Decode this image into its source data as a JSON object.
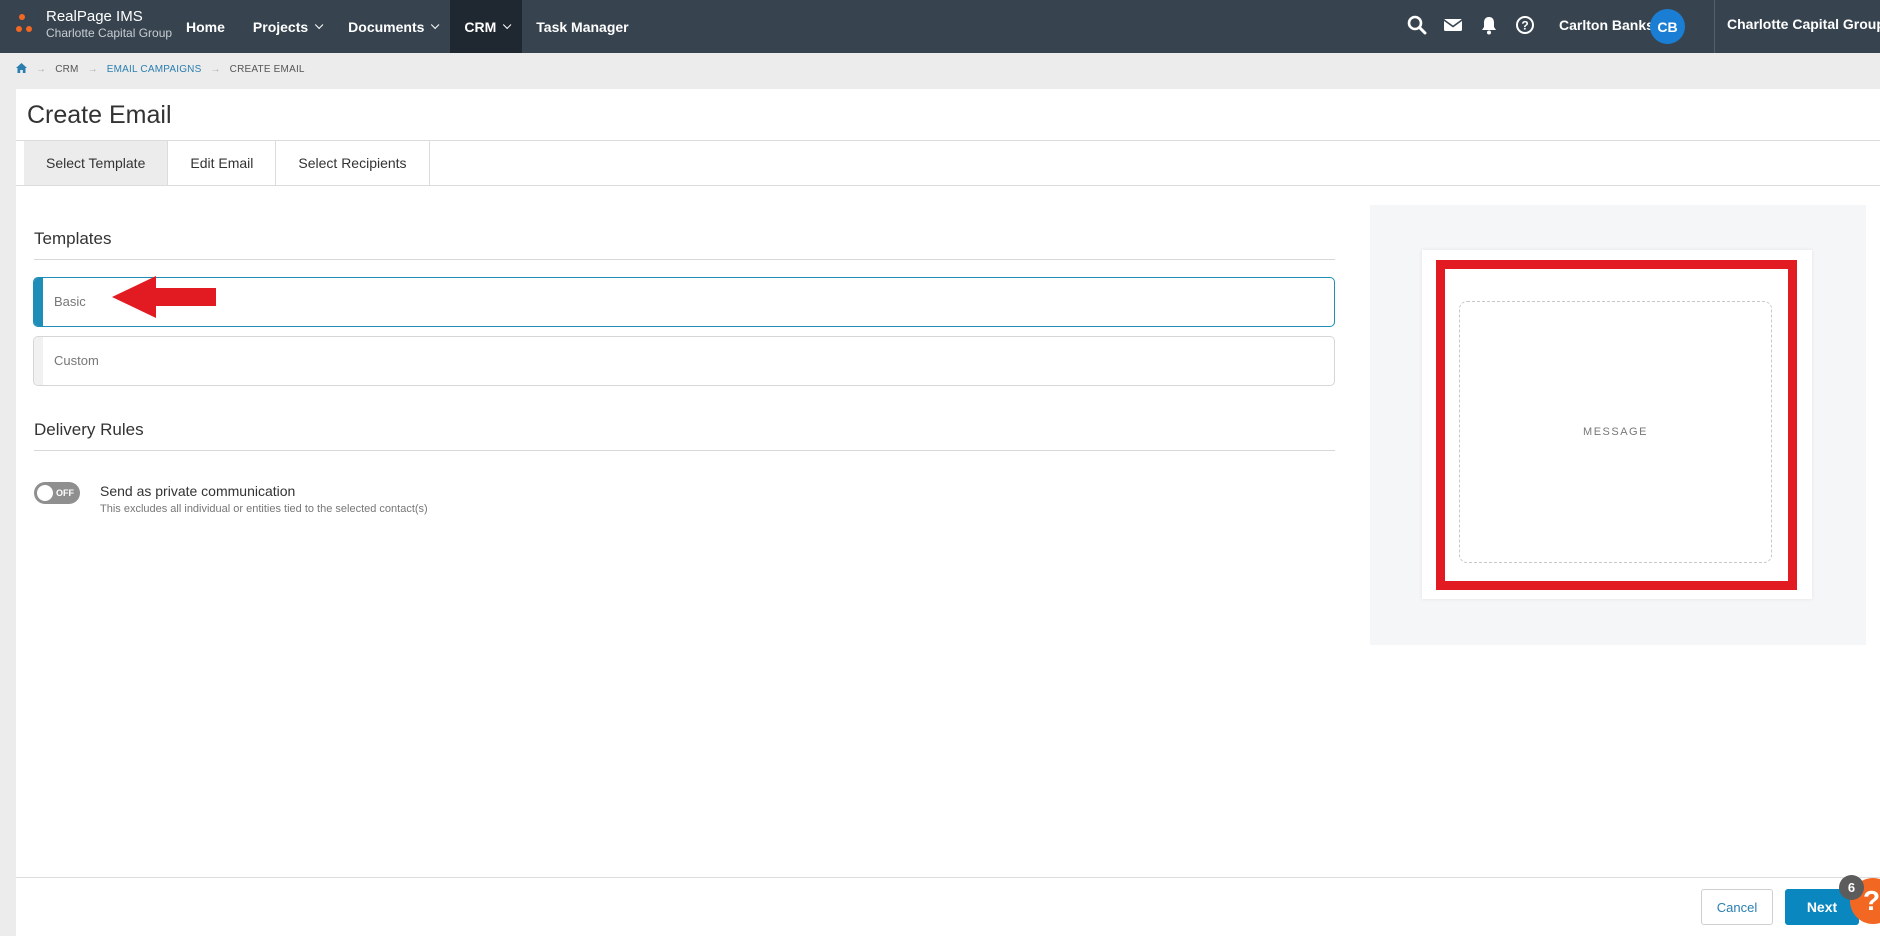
{
  "brand": {
    "name": "RealPage IMS",
    "subtitle": "Charlotte Capital Group",
    "accent": "#f26722"
  },
  "nav": {
    "items": [
      {
        "label": "Home",
        "dropdown": false
      },
      {
        "label": "Projects",
        "dropdown": true
      },
      {
        "label": "Documents",
        "dropdown": true
      },
      {
        "label": "CRM",
        "dropdown": true,
        "active": true
      },
      {
        "label": "Task Manager",
        "dropdown": false
      }
    ],
    "icons": [
      "search-icon",
      "mail-icon",
      "bell-icon",
      "help-icon"
    ],
    "user_name": "Carlton Banks",
    "user_initials": "CB",
    "org": "Charlotte Capital Group"
  },
  "breadcrumb": {
    "home_icon": "home-icon",
    "items": [
      "CRM",
      "EMAIL CAMPAIGNS",
      "CREATE EMAIL"
    ]
  },
  "page": {
    "title": "Create Email"
  },
  "tabs": [
    "Select Template",
    "Edit Email",
    "Select Recipients"
  ],
  "templates": {
    "title": "Templates",
    "items": [
      {
        "label": "Basic",
        "selected": true
      },
      {
        "label": "Custom",
        "selected": false
      }
    ]
  },
  "delivery": {
    "title": "Delivery Rules",
    "toggle_state": "OFF",
    "label": "Send as private communication",
    "description": "This excludes all individual or entities tied to the selected contact(s)"
  },
  "preview": {
    "message_label": "MESSAGE",
    "highlight_color": "#e21b23"
  },
  "footer": {
    "cancel_label": "Cancel",
    "next_label": "Next"
  },
  "help": {
    "badge_count": "6",
    "icon": "?"
  }
}
